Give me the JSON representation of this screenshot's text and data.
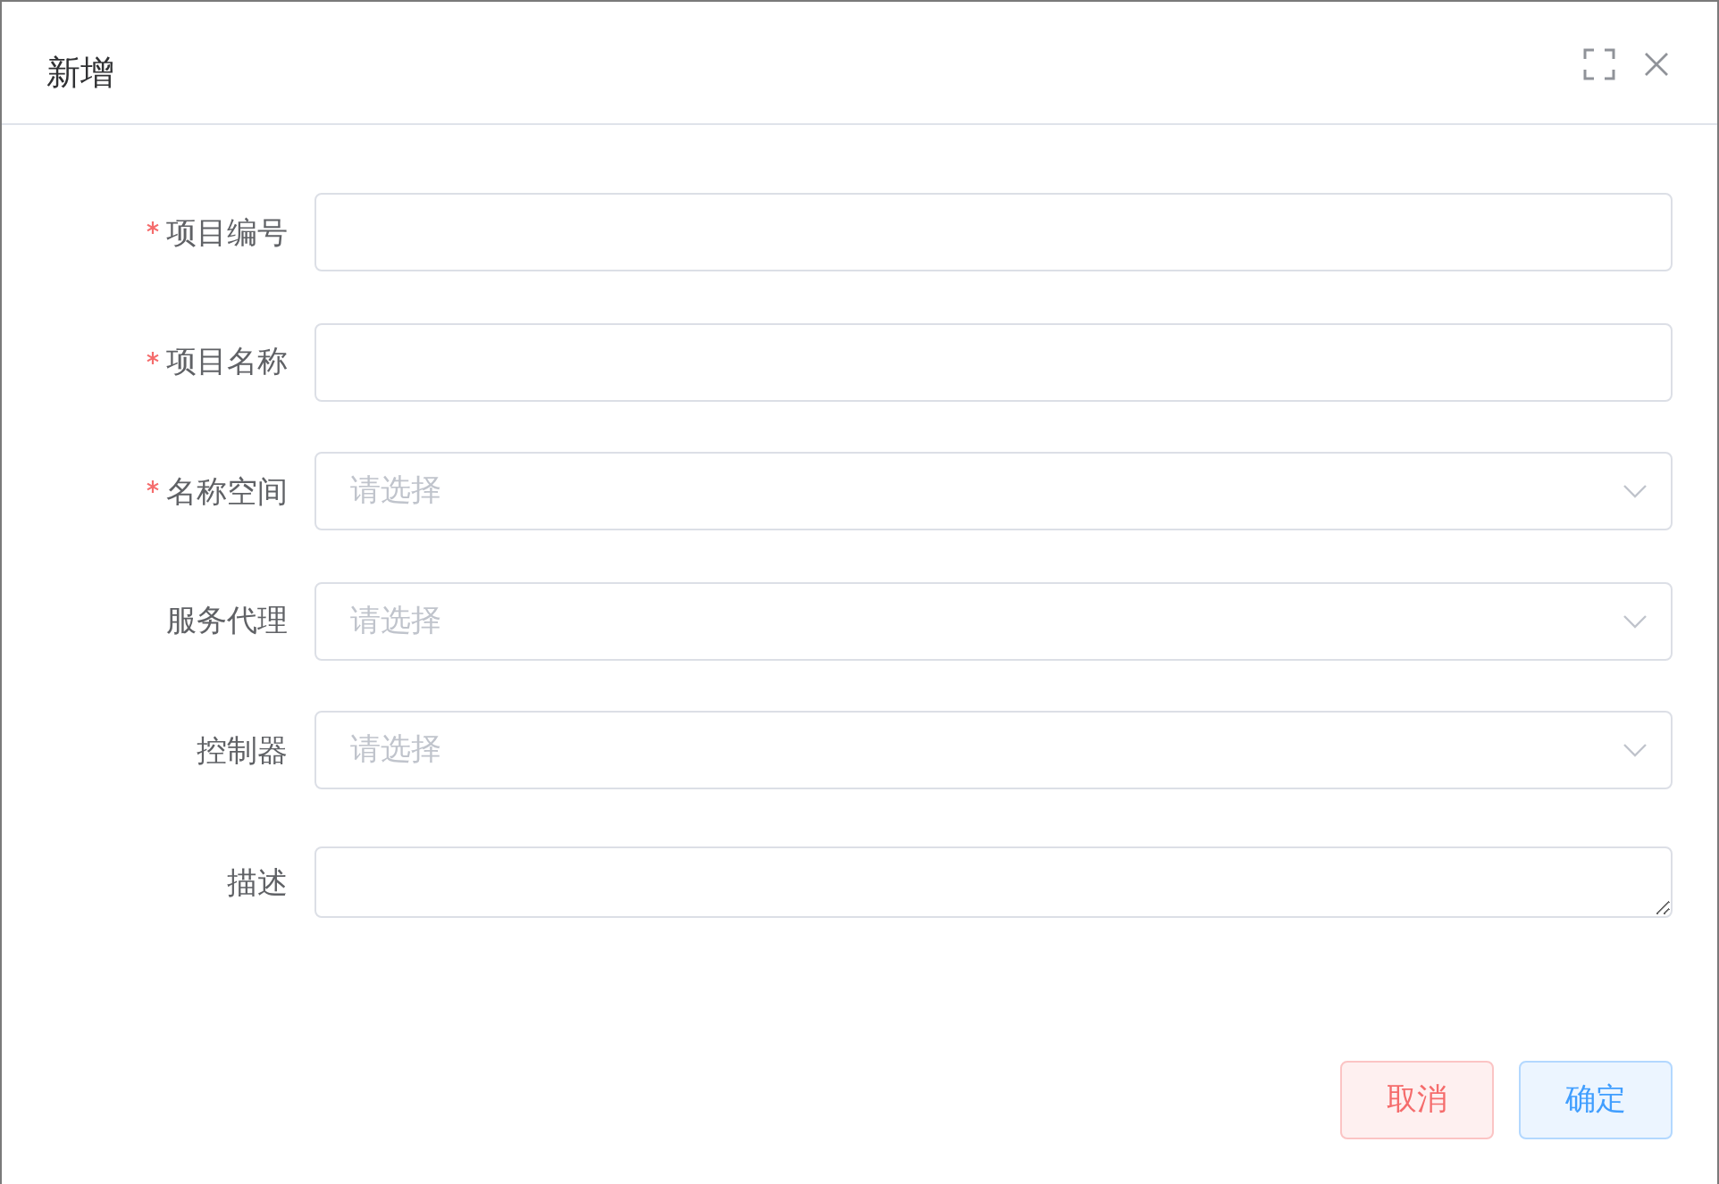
{
  "dialog": {
    "title": "新增"
  },
  "form": {
    "fields": [
      {
        "label": "项目编号",
        "required": true,
        "kind": "input"
      },
      {
        "label": "项目名称",
        "required": true,
        "kind": "input"
      },
      {
        "label": "名称空间",
        "required": true,
        "kind": "select",
        "placeholder": "请选择"
      },
      {
        "label": "服务代理",
        "required": false,
        "kind": "select",
        "placeholder": "请选择"
      },
      {
        "label": "控制器",
        "required": false,
        "kind": "select",
        "placeholder": "请选择"
      },
      {
        "label": "描述",
        "required": false,
        "kind": "textarea"
      }
    ]
  },
  "buttons": [
    {
      "label": "取消",
      "kind": "cancel"
    },
    {
      "label": "确定",
      "kind": "confirm"
    }
  ]
}
